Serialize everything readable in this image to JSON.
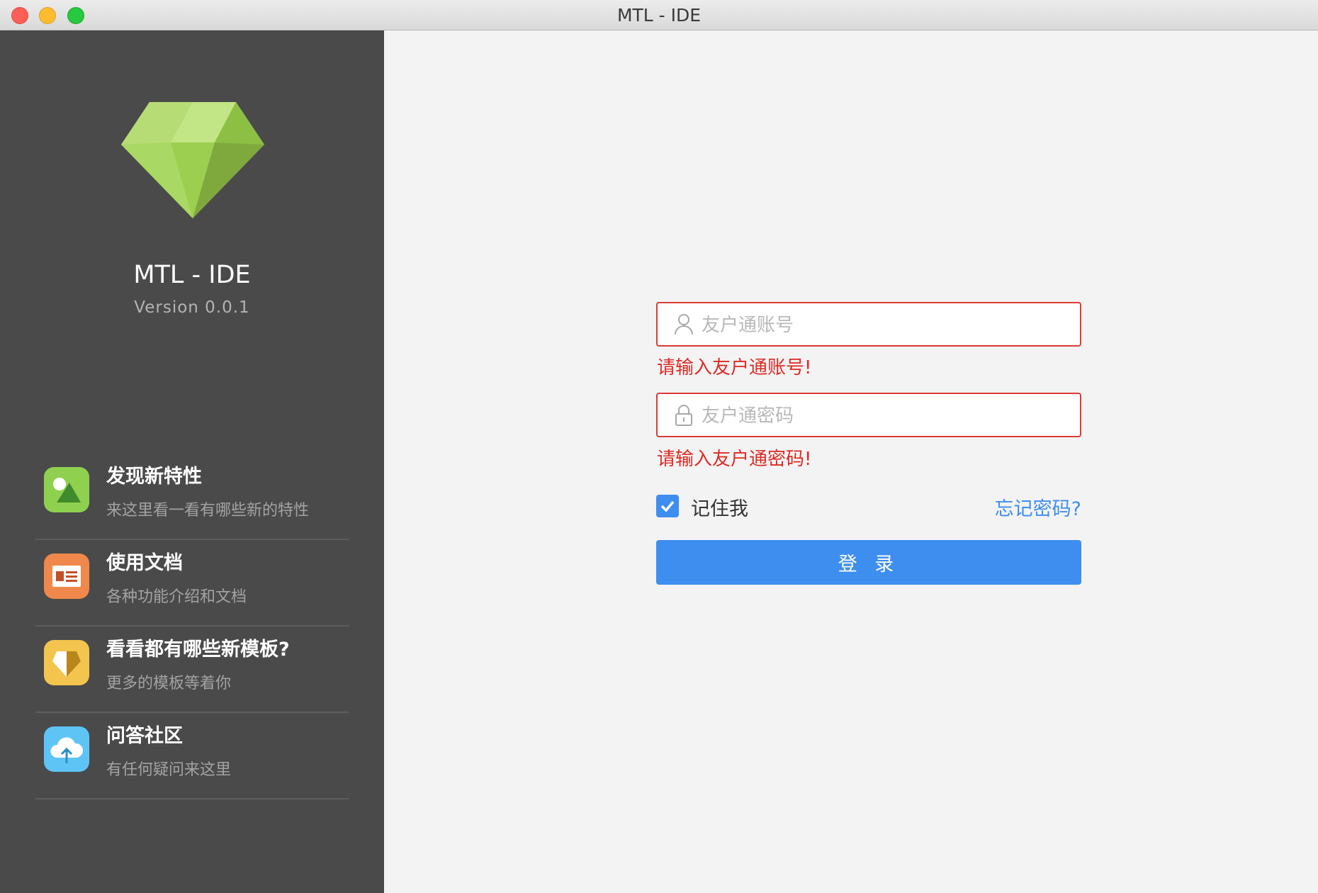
{
  "window": {
    "title": "MTL - IDE"
  },
  "sidebar": {
    "app_name": "MTL - IDE",
    "version": "Version 0.0.1",
    "items": [
      {
        "title": "发现新特性",
        "subtitle": "来这里看一看有哪些新的特性",
        "icon": "picture-icon",
        "color": "#8fd14f"
      },
      {
        "title": "使用文档",
        "subtitle": "各种功能介绍和文档",
        "icon": "document-icon",
        "color": "#f0884b"
      },
      {
        "title": "看看都有哪些新模板?",
        "subtitle": "更多的模板等着你",
        "icon": "template-icon",
        "color": "#f3c44e"
      },
      {
        "title": "问答社区",
        "subtitle": "有任何疑问来这里",
        "icon": "cloud-upload-icon",
        "color": "#5ec4f5"
      }
    ]
  },
  "login": {
    "account": {
      "placeholder": "友户通账号",
      "value": "",
      "error": "请输入友户通账号!"
    },
    "password": {
      "placeholder": "友户通密码",
      "value": "",
      "error": "请输入友户通密码!"
    },
    "remember": {
      "label": "记住我",
      "checked": true
    },
    "forgot_label": "忘记密码?",
    "submit_label": "登 录"
  },
  "colors": {
    "sidebar_bg": "#4a4a4a",
    "main_bg": "#f3f3f3",
    "accent": "#3e8ef0",
    "error": "#dd2a24",
    "logo_green": "#9ccf4f"
  }
}
